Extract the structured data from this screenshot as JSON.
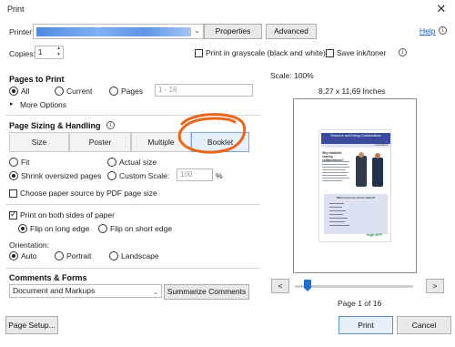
{
  "window": {
    "title": "Print",
    "close_glyph": "✕"
  },
  "printer": {
    "label": "Printer:",
    "properties_button": "Properties",
    "advanced_button": "Advanced",
    "help_link": "Help"
  },
  "copies": {
    "label": "Copies:",
    "value": "1"
  },
  "options": {
    "grayscale_label": "Print in grayscale (black and white)",
    "save_ink_label": "Save ink/toner"
  },
  "pages_to_print": {
    "title": "Pages to Print",
    "all": "All",
    "current": "Current",
    "pages": "Pages",
    "pages_range": "1 - 16",
    "more_options": "More Options"
  },
  "page_sizing": {
    "title": "Page Sizing & Handling",
    "tabs": [
      "Size",
      "Poster",
      "Multiple",
      "Booklet"
    ],
    "active_tab": "Booklet",
    "fit": "Fit",
    "actual_size": "Actual size",
    "shrink": "Shrink oversized pages",
    "custom_scale": "Custom Scale:",
    "custom_scale_value": "100",
    "percent": "%",
    "choose_source": "Choose paper source by PDF page size"
  },
  "duplex": {
    "print_both": "Print on both sides of paper",
    "flip_long": "Flip on long edge",
    "flip_short": "Flip on short edge"
  },
  "orientation": {
    "label": "Orientation:",
    "auto": "Auto",
    "portrait": "Portrait",
    "landscape": "Landscape"
  },
  "comments_forms": {
    "title": "Comments & Forms",
    "value": "Document and Markups",
    "summarize_button": "Summarize Comments"
  },
  "preview": {
    "scale": "Scale: 100%",
    "paper_size": "8,27 x 11,69 Inches",
    "prev": "<",
    "next": ">",
    "page_label": "Page 1 of 16",
    "doc_title": "Resource and Energy Collaborations",
    "doc_subtitle": "a Handbook",
    "doc_heading": "Why establish sharing collaborations?",
    "doc_box_title": "What resources can be shared?",
    "doc_logo": "high EFF",
    "slider_position": 0.1
  },
  "footer": {
    "page_setup": "Page Setup...",
    "print": "Print",
    "cancel": "Cancel"
  },
  "colors": {
    "accent": "#1f6fd1",
    "annotation": "#e8661c",
    "doc_band": "#3b4a9c"
  }
}
